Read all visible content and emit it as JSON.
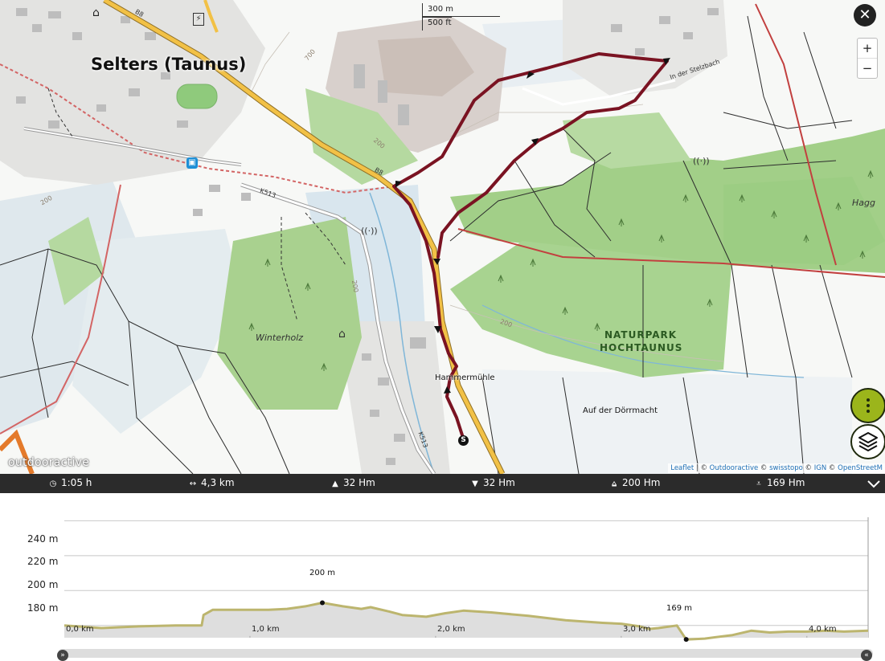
{
  "map": {
    "scale": {
      "meters": "300 m",
      "feet": "500 ft"
    },
    "labels": {
      "town": "Selters (Taunus)",
      "park_line1": "NATURPARK",
      "park_line2": "HOCHTAUNUS",
      "winterholz": "Winterholz",
      "hagg": "Hagg",
      "hammermuehle": "Hammermühle",
      "doerrmacht": "Auf der Dörrmacht",
      "stelzbach": "In der Stelzbach",
      "road_b8": "B8",
      "road_k513": "K513",
      "elev_200": "200",
      "elev_700": "700"
    },
    "start_marker": "S",
    "watermark": "outdooractive",
    "attribution": {
      "leaflet": "Leaflet",
      "sep": " | © ",
      "oa": "Outdooractive",
      "c1": " © ",
      "swisstopo": "swisstopo",
      "c2": " © ",
      "ign": "IGN",
      "c3": " © ",
      "osm": "OpenStreetM"
    },
    "controls": {
      "close": "✕",
      "zoom_in": "+",
      "zoom_out": "−"
    }
  },
  "stats": {
    "duration": "1:05 h",
    "distance": "4,3 km",
    "ascent": "32 Hm",
    "descent": "32 Hm",
    "max_alt": "200 Hm",
    "min_alt": "169 Hm"
  },
  "profile": {
    "y_labels": [
      "240 m",
      "220 m",
      "200 m",
      "180 m"
    ],
    "x_labels": [
      "0,0 km",
      "1,0 km",
      "2,0 km",
      "3,0 km",
      "4,0 km"
    ],
    "max_label": "200 m",
    "min_label": "169 m"
  },
  "chart_data": {
    "type": "area",
    "xlabel": "",
    "ylabel": "",
    "xlim": [
      0,
      4.33
    ],
    "ylim": [
      173,
      242
    ],
    "grid": true,
    "x_unit": "km",
    "y_unit": "m",
    "x": [
      0,
      0.2,
      0.4,
      0.6,
      0.74,
      0.75,
      0.8,
      0.9,
      1.0,
      1.1,
      1.2,
      1.3,
      1.39,
      1.5,
      1.6,
      1.65,
      1.75,
      1.82,
      1.95,
      2.05,
      2.15,
      2.3,
      2.5,
      2.7,
      2.9,
      3.0,
      3.1,
      3.15,
      3.2,
      3.3,
      3.35,
      3.45,
      3.6,
      3.7,
      3.8,
      3.9,
      4.0,
      4.1,
      4.2,
      4.33
    ],
    "y": [
      180,
      178.5,
      179.5,
      180,
      180,
      186,
      189,
      189,
      189,
      189,
      189.5,
      191,
      193,
      191,
      189.5,
      190.5,
      188,
      186,
      185,
      187,
      188.5,
      187.5,
      185.5,
      183,
      181.5,
      181,
      179.5,
      178,
      178.5,
      180,
      172,
      172.5,
      174.5,
      177,
      176,
      176.5,
      176.5,
      177,
      176.5,
      177
    ],
    "points": [
      {
        "label": "200 m",
        "x": 1.39,
        "y": 193
      },
      {
        "label": "169 m",
        "x": 3.35,
        "y": 172
      }
    ]
  },
  "colors": {
    "route": "#7a1322",
    "forest": "#9ccf85",
    "water": "#cfe0ea",
    "road_main": "#f2c146",
    "profile_line": "#bcb56e",
    "profile_fill": "#dedede",
    "accent": "#9bb51b"
  }
}
